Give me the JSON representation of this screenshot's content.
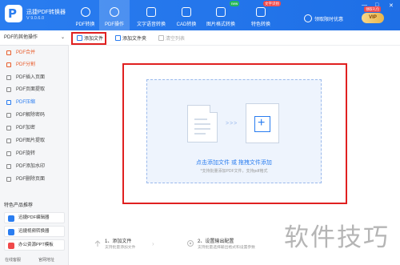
{
  "app": {
    "name": "迅捷PDF转换器",
    "version": "V 9.0.6.0"
  },
  "nav": [
    {
      "label": "PDF转换"
    },
    {
      "label": "PDF操作"
    },
    {
      "label": "文字语音转换"
    },
    {
      "label": "CAD转换"
    },
    {
      "label": "图片格式转换",
      "badge": "new"
    },
    {
      "label": "特色转换",
      "badge": "文字识别"
    }
  ],
  "user": {
    "login": "领取限时优惠",
    "vip": "VIP",
    "vip_tag": "领取礼包"
  },
  "window_controls": [
    "—",
    "□",
    "✕"
  ],
  "sidebar": {
    "title": "PDF的其他操作",
    "items": [
      {
        "label": "PDF合并"
      },
      {
        "label": "PDF分割"
      },
      {
        "label": "PDF插入页面"
      },
      {
        "label": "PDF页面提取"
      },
      {
        "label": "PDF压缩"
      },
      {
        "label": "PDF解除密码"
      },
      {
        "label": "PDF加密"
      },
      {
        "label": "PDF图片提取"
      },
      {
        "label": "PDF旋转"
      },
      {
        "label": "PDF添加水印"
      },
      {
        "label": "PDF删除页面"
      }
    ],
    "promo_title": "特色产品推荐",
    "promos": [
      {
        "label": "迅捷PDF编辑器"
      },
      {
        "label": "迅捷视频转换器"
      },
      {
        "label": "办公资源PPT模板"
      }
    ],
    "footer": {
      "service": "在线客服",
      "website": "官网地址"
    }
  },
  "toolbar": {
    "add_file": "添加文件",
    "add_folder": "添加文件夹",
    "clear_list": "清空列表"
  },
  "dropzone": {
    "main": "点击添加文件 或 拖拽文件添加",
    "hint": "*支持批量添加PDF文件，支持pdf格式"
  },
  "steps": [
    {
      "title": "1、添加文件",
      "desc": "支持批量添加文件"
    },
    {
      "title": "2、设置输出配置",
      "desc": "支持批量选择输出格式和设置参数"
    }
  ],
  "watermark": "软件技巧",
  "colors": {
    "header": "#2a7df0",
    "accent": "#2a7df0",
    "active_side": "#e85c2b",
    "highlight_box": "#e02020"
  }
}
